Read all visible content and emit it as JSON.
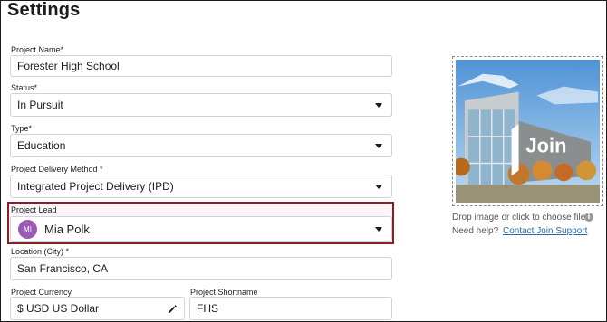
{
  "page": {
    "title": "Settings"
  },
  "form": {
    "project_name": {
      "label": "Project Name*",
      "value": "Forester High School"
    },
    "status": {
      "label": "Status*",
      "value": "In Pursuit"
    },
    "type": {
      "label": "Type*",
      "value": "Education"
    },
    "delivery_method": {
      "label": "Project Delivery Method *",
      "value": "Integrated Project Delivery (IPD)"
    },
    "project_lead": {
      "label": "Project Lead",
      "initials": "MI",
      "value": "Mia Polk",
      "avatar_color": "#9b59b6",
      "highlight_color": "#8f1d24"
    },
    "location": {
      "label": "Location (City) *",
      "value": "San Francisco, CA"
    },
    "currency": {
      "label": "Project Currency",
      "value": "$ USD US Dollar"
    },
    "shortname": {
      "label": "Project Shortname",
      "value": "FHS"
    }
  },
  "image_upload": {
    "watermark": "Join",
    "drop_text": "Drop image or click to choose file",
    "help_text": "Need help?",
    "help_link": "Contact Join Support"
  }
}
